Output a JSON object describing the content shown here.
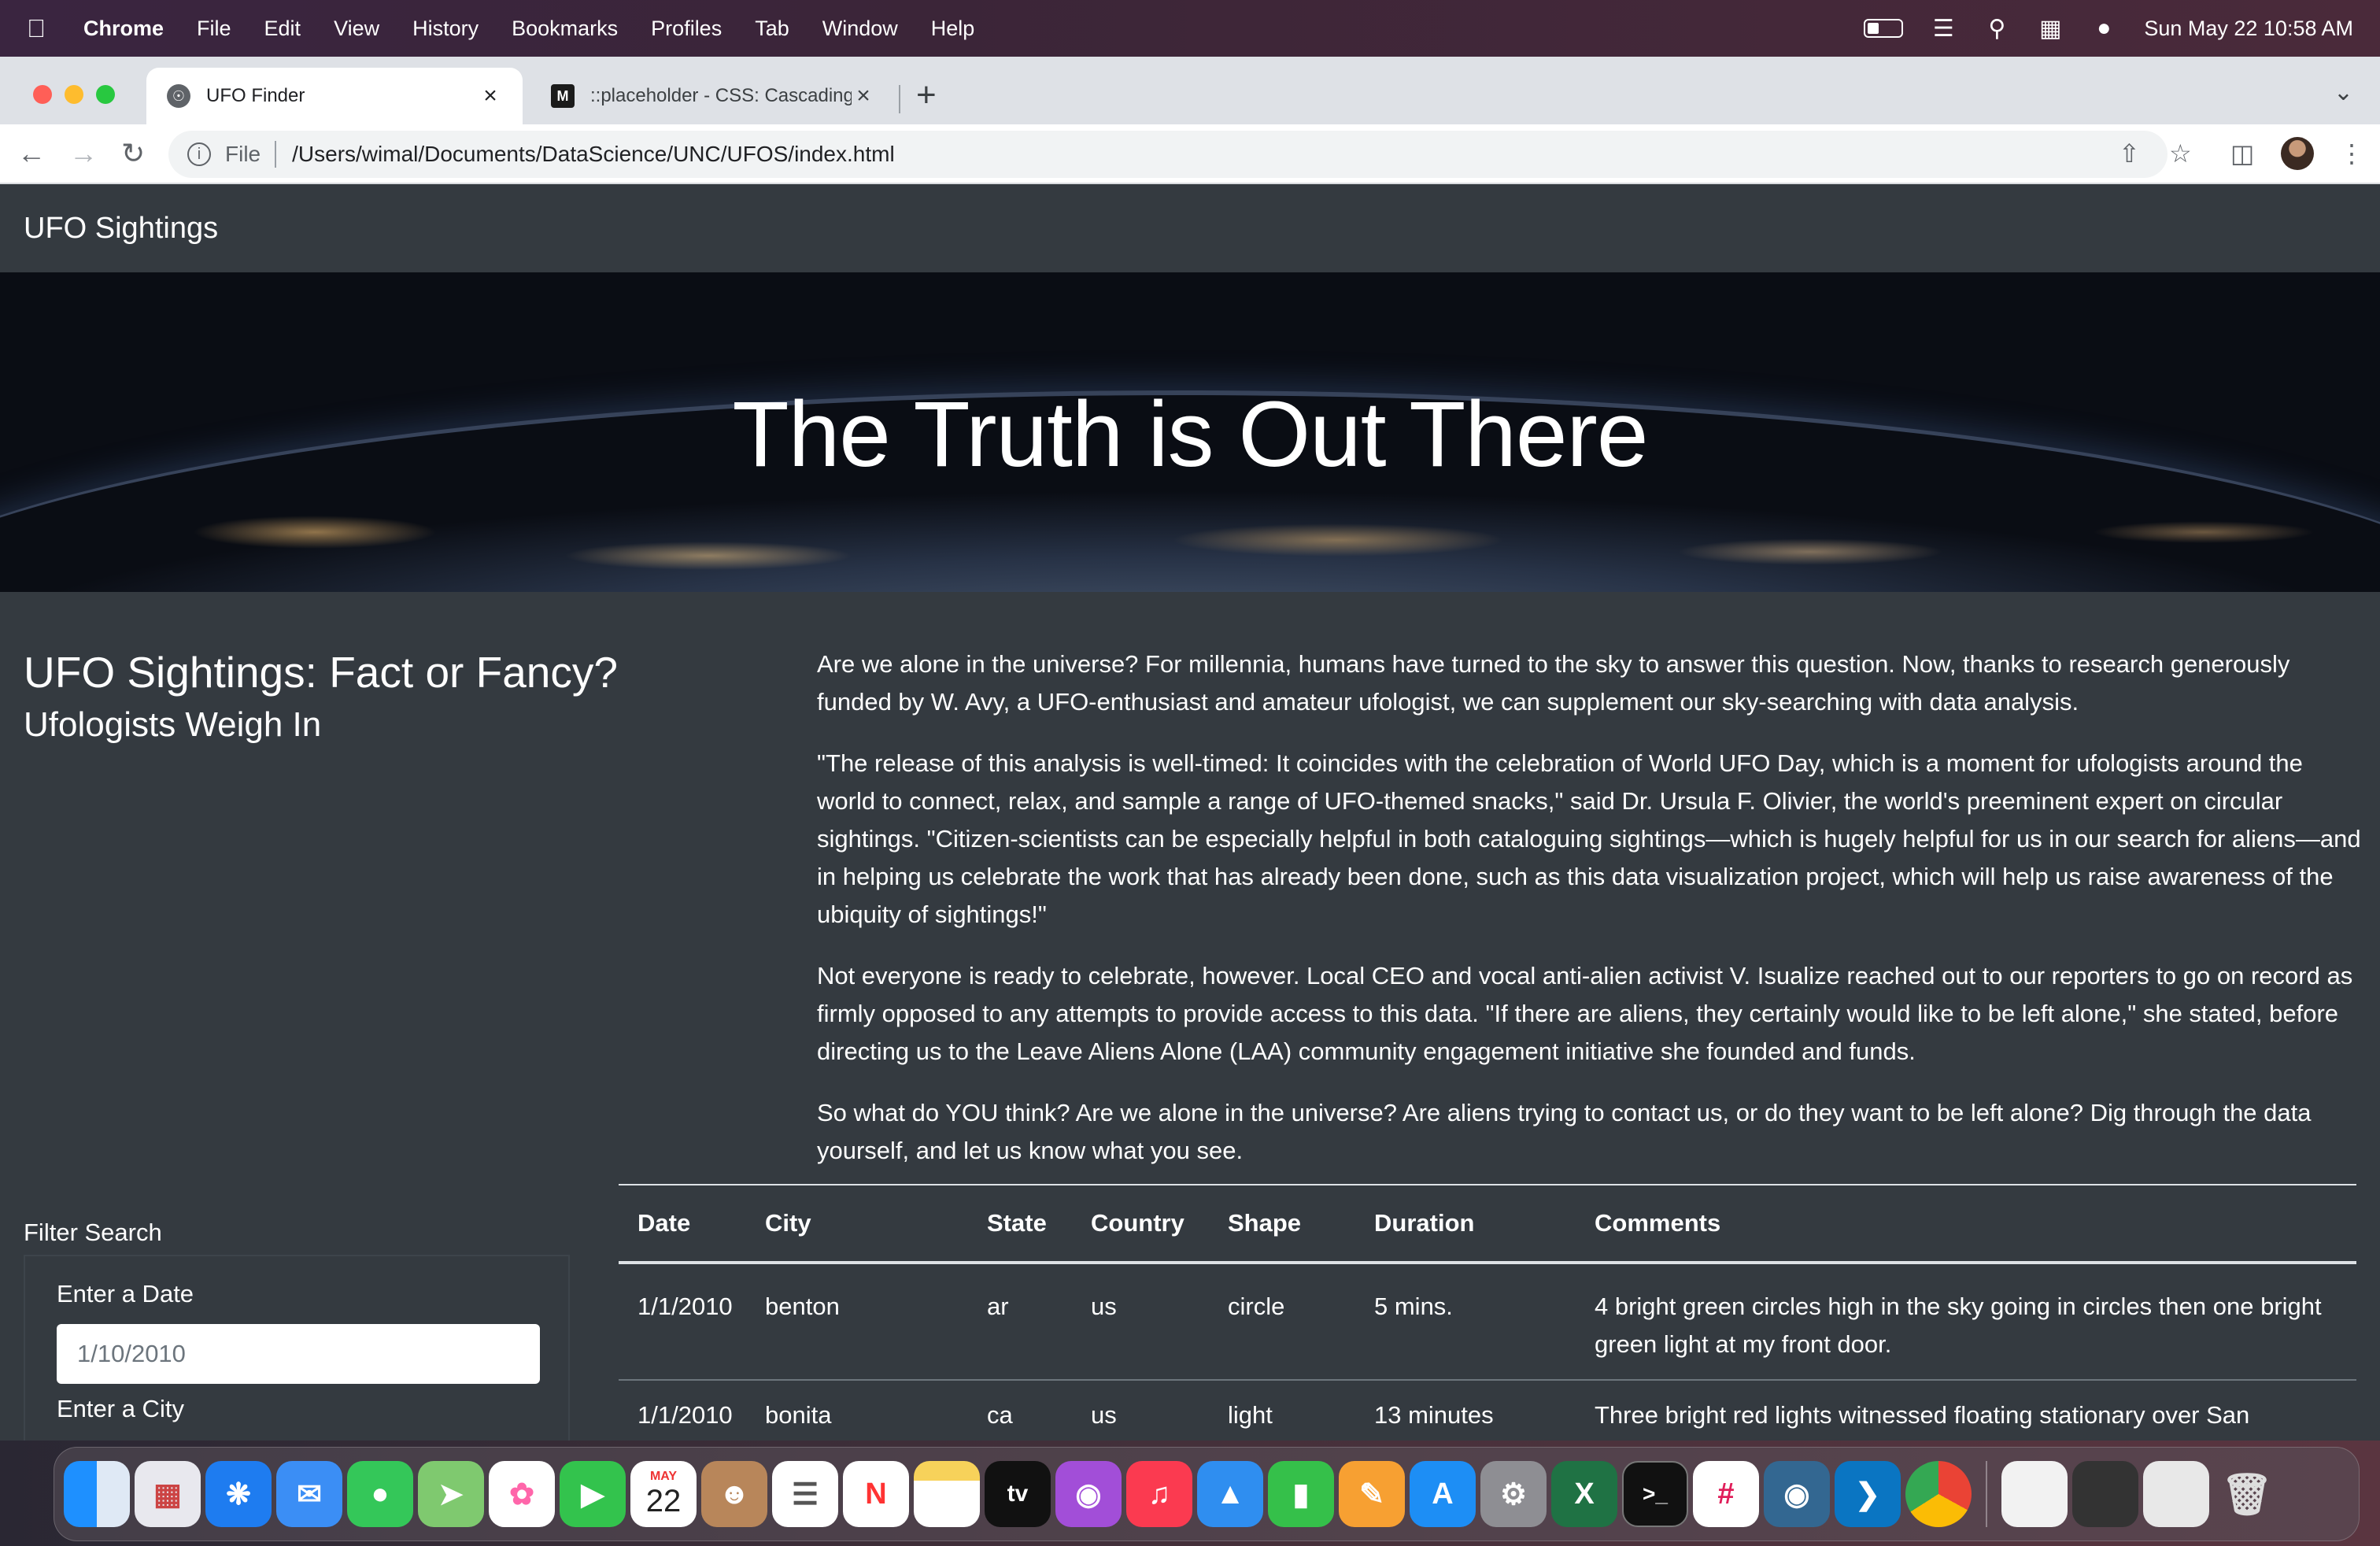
{
  "menubar": {
    "app": "Chrome",
    "items": [
      "File",
      "Edit",
      "View",
      "History",
      "Bookmarks",
      "Profiles",
      "Tab",
      "Window",
      "Help"
    ],
    "datetime": "Sun May 22  10:58 AM"
  },
  "browser": {
    "tabs": [
      {
        "title": "UFO Finder",
        "icon": "globe-icon",
        "active": true
      },
      {
        "title": "::placeholder - CSS: Cascading",
        "icon": "mdn-icon",
        "active": false
      }
    ],
    "omnibox": {
      "scheme": "File",
      "url": "/Users/wimal/Documents/DataScience/UNC/UFOS/index.html"
    }
  },
  "page": {
    "navbar_brand": "UFO Sightings",
    "hero_title": "The Truth is Out There",
    "heading": "UFO Sightings: Fact or Fancy?",
    "subheading": "Ufologists Weigh In",
    "article": [
      "Are we alone in the universe? For millennia, humans have turned to the sky to answer this question. Now, thanks to research generously funded by W. Avy, a UFO-enthusiast and amateur ufologist, we can supplement our sky-searching with data analysis.",
      "\"The release of this analysis is well-timed: It coincides with the celebration of World UFO Day, which is a moment for ufologists around the world to connect, relax, and sample a range of UFO-themed snacks,\" said Dr. Ursula F. Olivier, the world's preeminent expert on circular sightings. \"Citizen-scientists can be especially helpful in both cataloguing sightings—which is hugely helpful for us in our search for aliens—and in helping us celebrate the work that has already been done, such as this data visualization project, which will help us raise awareness of the ubiquity of sightings!\"",
      "Not everyone is ready to celebrate, however. Local CEO and vocal anti-alien activist V. Isualize reached out to our reporters to go on record as firmly opposed to any attempts to provide access to this data. \"If there are aliens, they certainly would like to be left alone,\" she stated, before directing us to the Leave Aliens Alone (LAA) community engagement initiative she founded and funds.",
      "So what do YOU think? Are we alone in the universe? Are aliens trying to contact us, or do they want to be left alone? Dig through the data yourself, and let us know what you see."
    ],
    "filter": {
      "title": "Filter Search",
      "date_label": "Enter a Date",
      "date_placeholder": "1/10/2010",
      "city_label": "Enter a City"
    },
    "table": {
      "headers": [
        "Date",
        "City",
        "State",
        "Country",
        "Shape",
        "Duration",
        "Comments"
      ],
      "rows": [
        [
          "1/1/2010",
          "benton",
          "ar",
          "us",
          "circle",
          "5 mins.",
          "4 bright green circles high in the sky going in circles then one bright green light at my front door."
        ],
        [
          "1/1/2010",
          "bonita",
          "ca",
          "us",
          "light",
          "13 minutes",
          "Three bright red lights witnessed floating stationary over San"
        ]
      ]
    }
  },
  "dock": {
    "apps": [
      "finder",
      "launchpad",
      "safari",
      "mail",
      "messages",
      "maps",
      "photos",
      "facetime",
      "calendar",
      "contacts",
      "reminders",
      "news",
      "notes",
      "tv",
      "podcasts",
      "music",
      "keynote",
      "numbers",
      "pages",
      "app-store",
      "system-preferences",
      "excel",
      "terminal",
      "slack",
      "postgres",
      "vscode",
      "chrome"
    ],
    "calendar_month": "MAY",
    "calendar_day": "22",
    "tv_label": "tv"
  },
  "colors": {
    "page_bg": "#343a40",
    "navbar_text": "#ffffff",
    "accent": "#dee2e6"
  }
}
